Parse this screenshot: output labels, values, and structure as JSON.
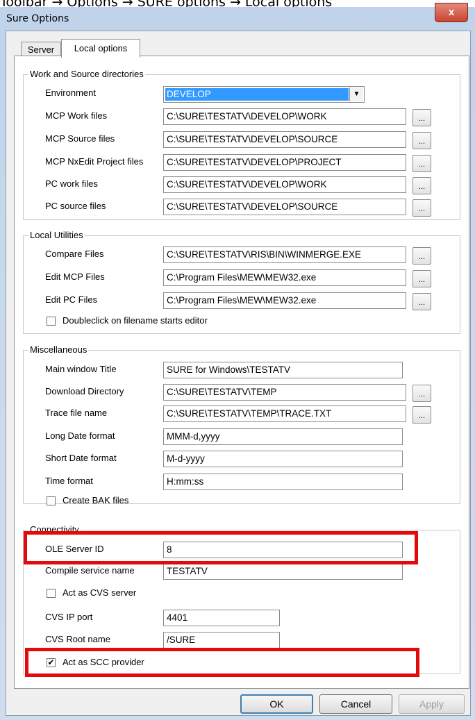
{
  "breadcrumb": "Toolbar → Options → SURE options → Local options",
  "window": {
    "title": "Sure Options",
    "close_glyph": "x"
  },
  "tabs": {
    "server": "Server",
    "local": "Local options"
  },
  "work_source": {
    "legend": "Work and Source directories",
    "environment_label": "Environment",
    "environment_value": "DEVELOP",
    "rows": [
      {
        "label": "MCP Work files",
        "value": "C:\\SURE\\TESTATV\\DEVELOP\\WORK"
      },
      {
        "label": "MCP Source files",
        "value": "C:\\SURE\\TESTATV\\DEVELOP\\SOURCE"
      },
      {
        "label": "MCP NxEdit Project files",
        "value": "C:\\SURE\\TESTATV\\DEVELOP\\PROJECT"
      },
      {
        "label": "PC work files",
        "value": "C:\\SURE\\TESTATV\\DEVELOP\\WORK"
      },
      {
        "label": "PC source files",
        "value": "C:\\SURE\\TESTATV\\DEVELOP\\SOURCE"
      }
    ]
  },
  "local_utilities": {
    "legend": "Local Utilities",
    "rows": [
      {
        "label": "Compare Files",
        "value": "C:\\SURE\\TESTATV\\RIS\\BIN\\WINMERGE.EXE"
      },
      {
        "label": "Edit MCP Files",
        "value": "C:\\Program Files\\MEW\\MEW32.exe"
      },
      {
        "label": "Edit PC Files",
        "value": "C:\\Program Files\\MEW\\MEW32.exe"
      }
    ],
    "doubleclick_label": "Doubleclick on filename starts editor"
  },
  "misc": {
    "legend": "Miscellaneous",
    "rows": [
      {
        "label": "Main window Title",
        "value": "SURE for Windows\\TESTATV"
      },
      {
        "label": "Download Directory",
        "value": "C:\\SURE\\TESTATV\\TEMP"
      },
      {
        "label": "Trace file name",
        "value": "C:\\SURE\\TESTATV\\TEMP\\TRACE.TXT"
      },
      {
        "label": "Long Date format",
        "value": "MMM-d,yyyy"
      },
      {
        "label": "Short Date format",
        "value": "M-d-yyyy"
      },
      {
        "label": "Time format",
        "value": "H:mm:ss"
      }
    ],
    "bak_label": "Create BAK files"
  },
  "connectivity": {
    "legend": "Connectivity",
    "ole_label": "OLE Server ID",
    "ole_value": "8",
    "compile_label": "Compile service name",
    "compile_value": "TESTATV",
    "cvs_server_label": "Act as CVS server",
    "cvs_port_label": "CVS IP port",
    "cvs_port_value": "4401",
    "cvs_root_label": "CVS Root name",
    "cvs_root_value": "/SURE",
    "scc_label": "Act as SCC provider",
    "scc_checked": true
  },
  "buttons": {
    "ok": "OK",
    "cancel": "Cancel",
    "apply": "Apply"
  },
  "browse_glyph": "...",
  "checkmark_glyph": "✔",
  "dropdown_glyph": "▼"
}
